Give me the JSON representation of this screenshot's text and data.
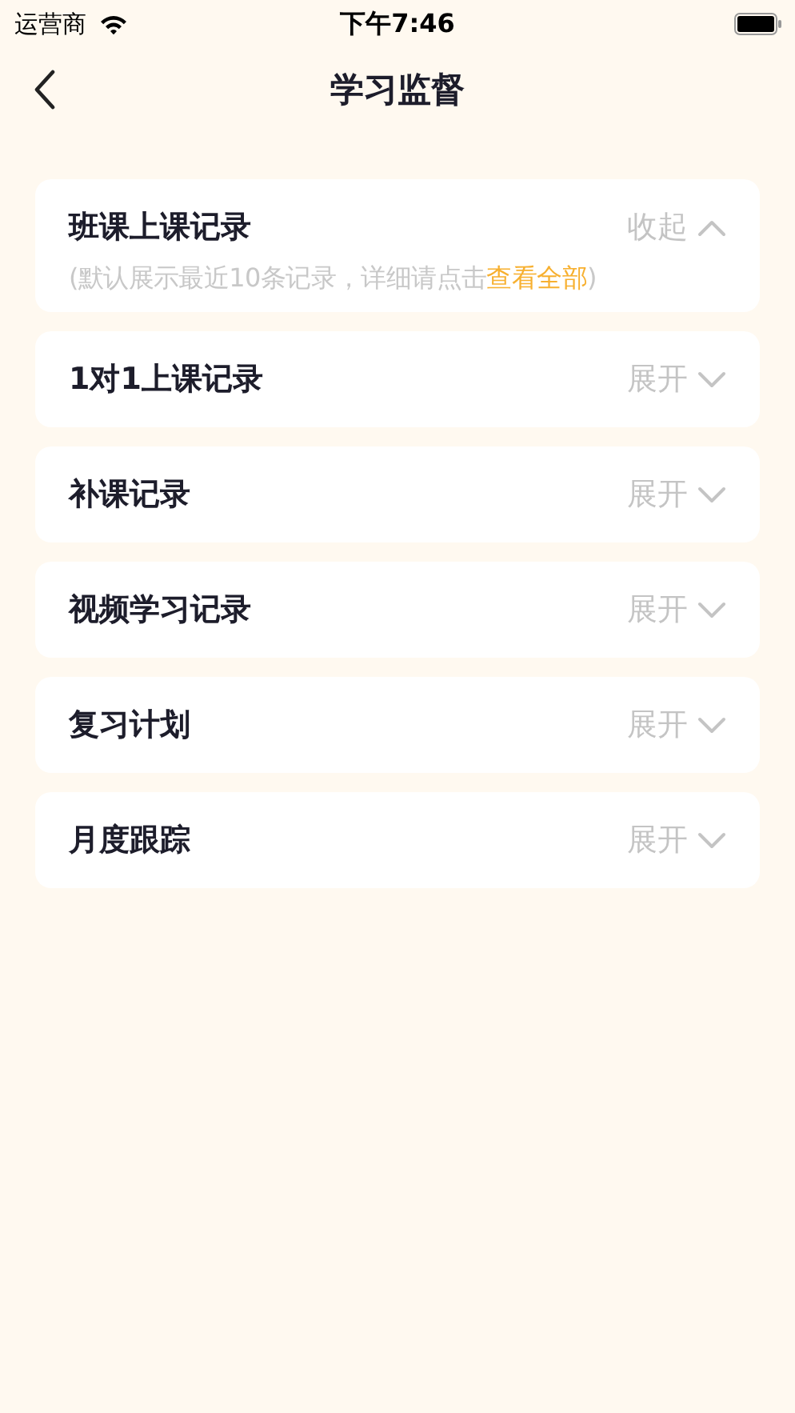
{
  "status_bar": {
    "carrier": "运营商",
    "time": "下午7:46"
  },
  "nav": {
    "title": "学习监督"
  },
  "sections": [
    {
      "title": "班课上课记录",
      "toggle": "收起",
      "expanded": true,
      "note": {
        "before": "(默认展示最近10条记录，详细请点击",
        "link": "查看全部",
        "after": ")"
      }
    },
    {
      "title": "1对1上课记录",
      "toggle": "展开",
      "expanded": false
    },
    {
      "title": "补课记录",
      "toggle": "展开",
      "expanded": false
    },
    {
      "title": "视频学习记录",
      "toggle": "展开",
      "expanded": false
    },
    {
      "title": "复习计划",
      "toggle": "展开",
      "expanded": false
    },
    {
      "title": "月度跟踪",
      "toggle": "展开",
      "expanded": false
    }
  ]
}
